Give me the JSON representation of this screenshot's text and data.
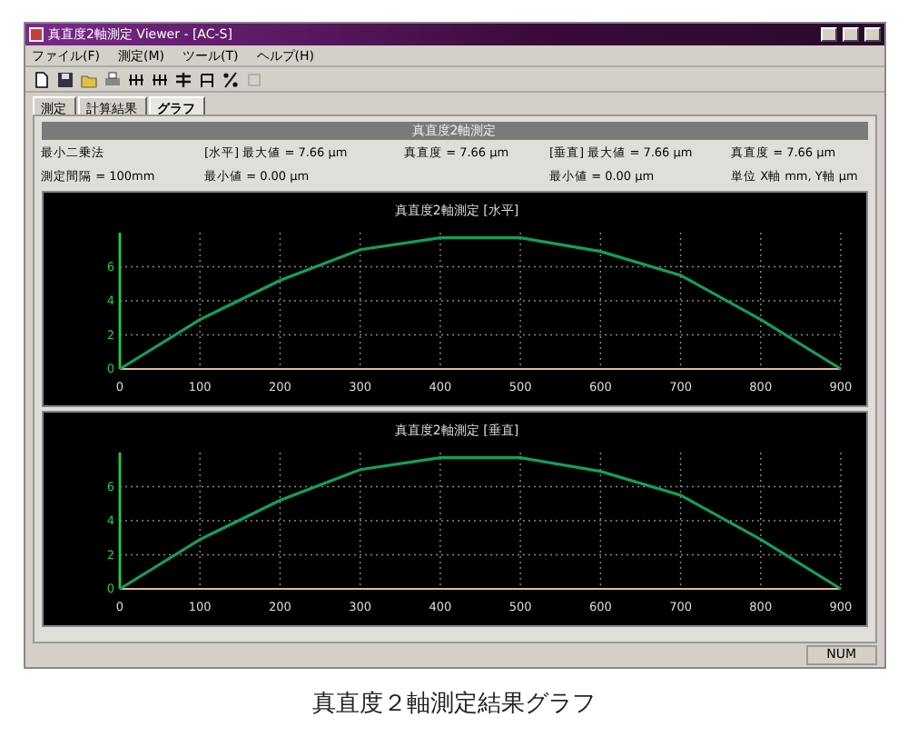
{
  "window": {
    "title": "真直度2軸測定 Viewer - [AC-S]"
  },
  "menu": [
    "ファイル(F)",
    "測定(M)",
    "ツール(T)",
    "ヘルプ(H)"
  ],
  "toolbar": [
    {
      "kind": "new"
    },
    {
      "kind": "save"
    },
    {
      "kind": "open"
    },
    {
      "kind": "print"
    },
    {
      "kind": "grid"
    },
    {
      "kind": "grid"
    },
    {
      "kind": "level"
    },
    {
      "kind": "angle"
    },
    {
      "kind": "percent"
    },
    {
      "kind": "disabled"
    }
  ],
  "tabs": [
    {
      "label": "測定",
      "selected": false
    },
    {
      "label": "計算結果",
      "selected": false
    },
    {
      "label": "グラフ",
      "selected": true
    }
  ],
  "panel_title": "真直度2軸測定",
  "info": {
    "row_1": [
      "最小二乗法",
      "[水平] 最大値 = 7.66 μm",
      "真直度 = 7.66 μm",
      "[垂直] 最大値 = 7.66 μm",
      "真直度 = 7.66 μm"
    ],
    "row_2": [
      "測定間隔 = 100mm",
      "最小値 = 0.00 μm",
      "最小値 = 0.00 μm",
      "単位 X軸 mm, Y軸 μm"
    ]
  },
  "charts": [
    {
      "chart_data": {
        "type": "line",
        "title": "真直度2軸測定 [水平]",
        "x": [
          0,
          100,
          200,
          300,
          400,
          500,
          600,
          700,
          800,
          900
        ],
        "series": [
          {
            "color": "#12a05a",
            "values": [
              0,
              2.9,
              5.2,
              7.0,
              7.7,
              7.7,
              6.9,
              5.5,
              2.9,
              0
            ]
          }
        ],
        "xlim": [
          0,
          900
        ],
        "ylim": [
          0,
          8
        ],
        "grid": true,
        "xticks": [
          0,
          100,
          200,
          300,
          400,
          500,
          600,
          700,
          800,
          900
        ],
        "yticks": [
          0,
          2,
          4,
          6
        ]
      }
    },
    {
      "chart_data": {
        "type": "line",
        "title": "真直度2軸測定 [垂直]",
        "x": [
          0,
          100,
          200,
          300,
          400,
          500,
          600,
          700,
          800,
          900
        ],
        "series": [
          {
            "color": "#12a05a",
            "values": [
              0,
              2.9,
              5.2,
              7.0,
              7.7,
              7.7,
              6.9,
              5.5,
              2.9,
              0
            ]
          }
        ],
        "xlim": [
          0,
          900
        ],
        "ylim": [
          0,
          8
        ],
        "grid": true,
        "xticks": [
          0,
          100,
          200,
          300,
          400,
          500,
          600,
          700,
          800,
          900
        ],
        "yticks": [
          0,
          2,
          4,
          6
        ]
      }
    }
  ],
  "status_bar": {
    "indicator": "NUM"
  },
  "caption": "真直度２軸測定結果グラフ"
}
